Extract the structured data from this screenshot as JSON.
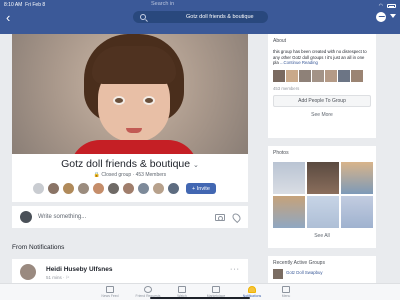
{
  "status_bar": {
    "time": "8:10 AM",
    "date": "Fri Feb 8"
  },
  "header": {
    "back_icon": "chevron-left-icon",
    "search_placeholder": "Search in",
    "search_query": "Gotz doll friends & boutique",
    "messenger_icon": "messenger-icon"
  },
  "group": {
    "name": "Gotz doll friends & boutique",
    "chevron": "⌄",
    "meta": "🔒 Closed group · 453 Members",
    "invite_label": "+ Invite"
  },
  "composer": {
    "placeholder": "Write something..."
  },
  "notifications": {
    "heading": "From Notifications",
    "post": {
      "author": "Heidi Huseby Ulfsnes",
      "time": "51 mins · ⚐",
      "more": "···"
    }
  },
  "about": {
    "heading": "About",
    "text": "this group has been created with no disrespect to any other Gotz doll groups I it's just an all in one pla",
    "more_link": "...Continue Reading",
    "member_count": "453 members",
    "add_people_label": "Add People To Group",
    "see_more_label": "See More"
  },
  "photos": {
    "heading": "Photos",
    "see_all_label": "See All"
  },
  "recent_groups": {
    "heading": "Recently Active Groups",
    "item": "Gotz Doll Swapbuy"
  },
  "tabbar": {
    "items": [
      {
        "label": "News Feed",
        "icon": "news-feed-icon"
      },
      {
        "label": "Friend Requests",
        "icon": "friends-icon"
      },
      {
        "label": "Watch",
        "icon": "watch-icon"
      },
      {
        "label": "Marketplace",
        "icon": "marketplace-icon"
      },
      {
        "label": "Notifications",
        "icon": "bell-icon"
      },
      {
        "label": "Menu",
        "icon": "menu-icon"
      }
    ]
  },
  "colors": {
    "brand": "#3b5998",
    "accent": "#4267b2",
    "background": "#e9ebee"
  }
}
